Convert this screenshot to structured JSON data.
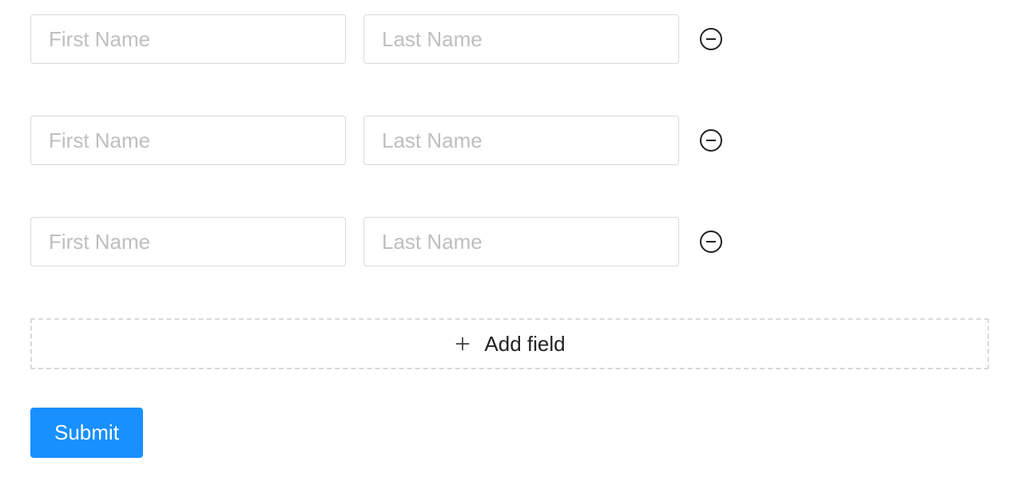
{
  "form": {
    "rows": [
      {
        "first_value": "",
        "first_placeholder": "First Name",
        "last_value": "",
        "last_placeholder": "Last Name"
      },
      {
        "first_value": "",
        "first_placeholder": "First Name",
        "last_value": "",
        "last_placeholder": "Last Name"
      },
      {
        "first_value": "",
        "first_placeholder": "First Name",
        "last_value": "",
        "last_placeholder": "Last Name"
      }
    ],
    "add_field_label": "Add field",
    "submit_label": "Submit"
  },
  "icons": {
    "plus": "plus-icon",
    "minus_circle": "minus-circle-icon"
  },
  "colors": {
    "primary": "#1890ff",
    "border": "#d9d9d9",
    "placeholder": "#bfbfbf"
  }
}
